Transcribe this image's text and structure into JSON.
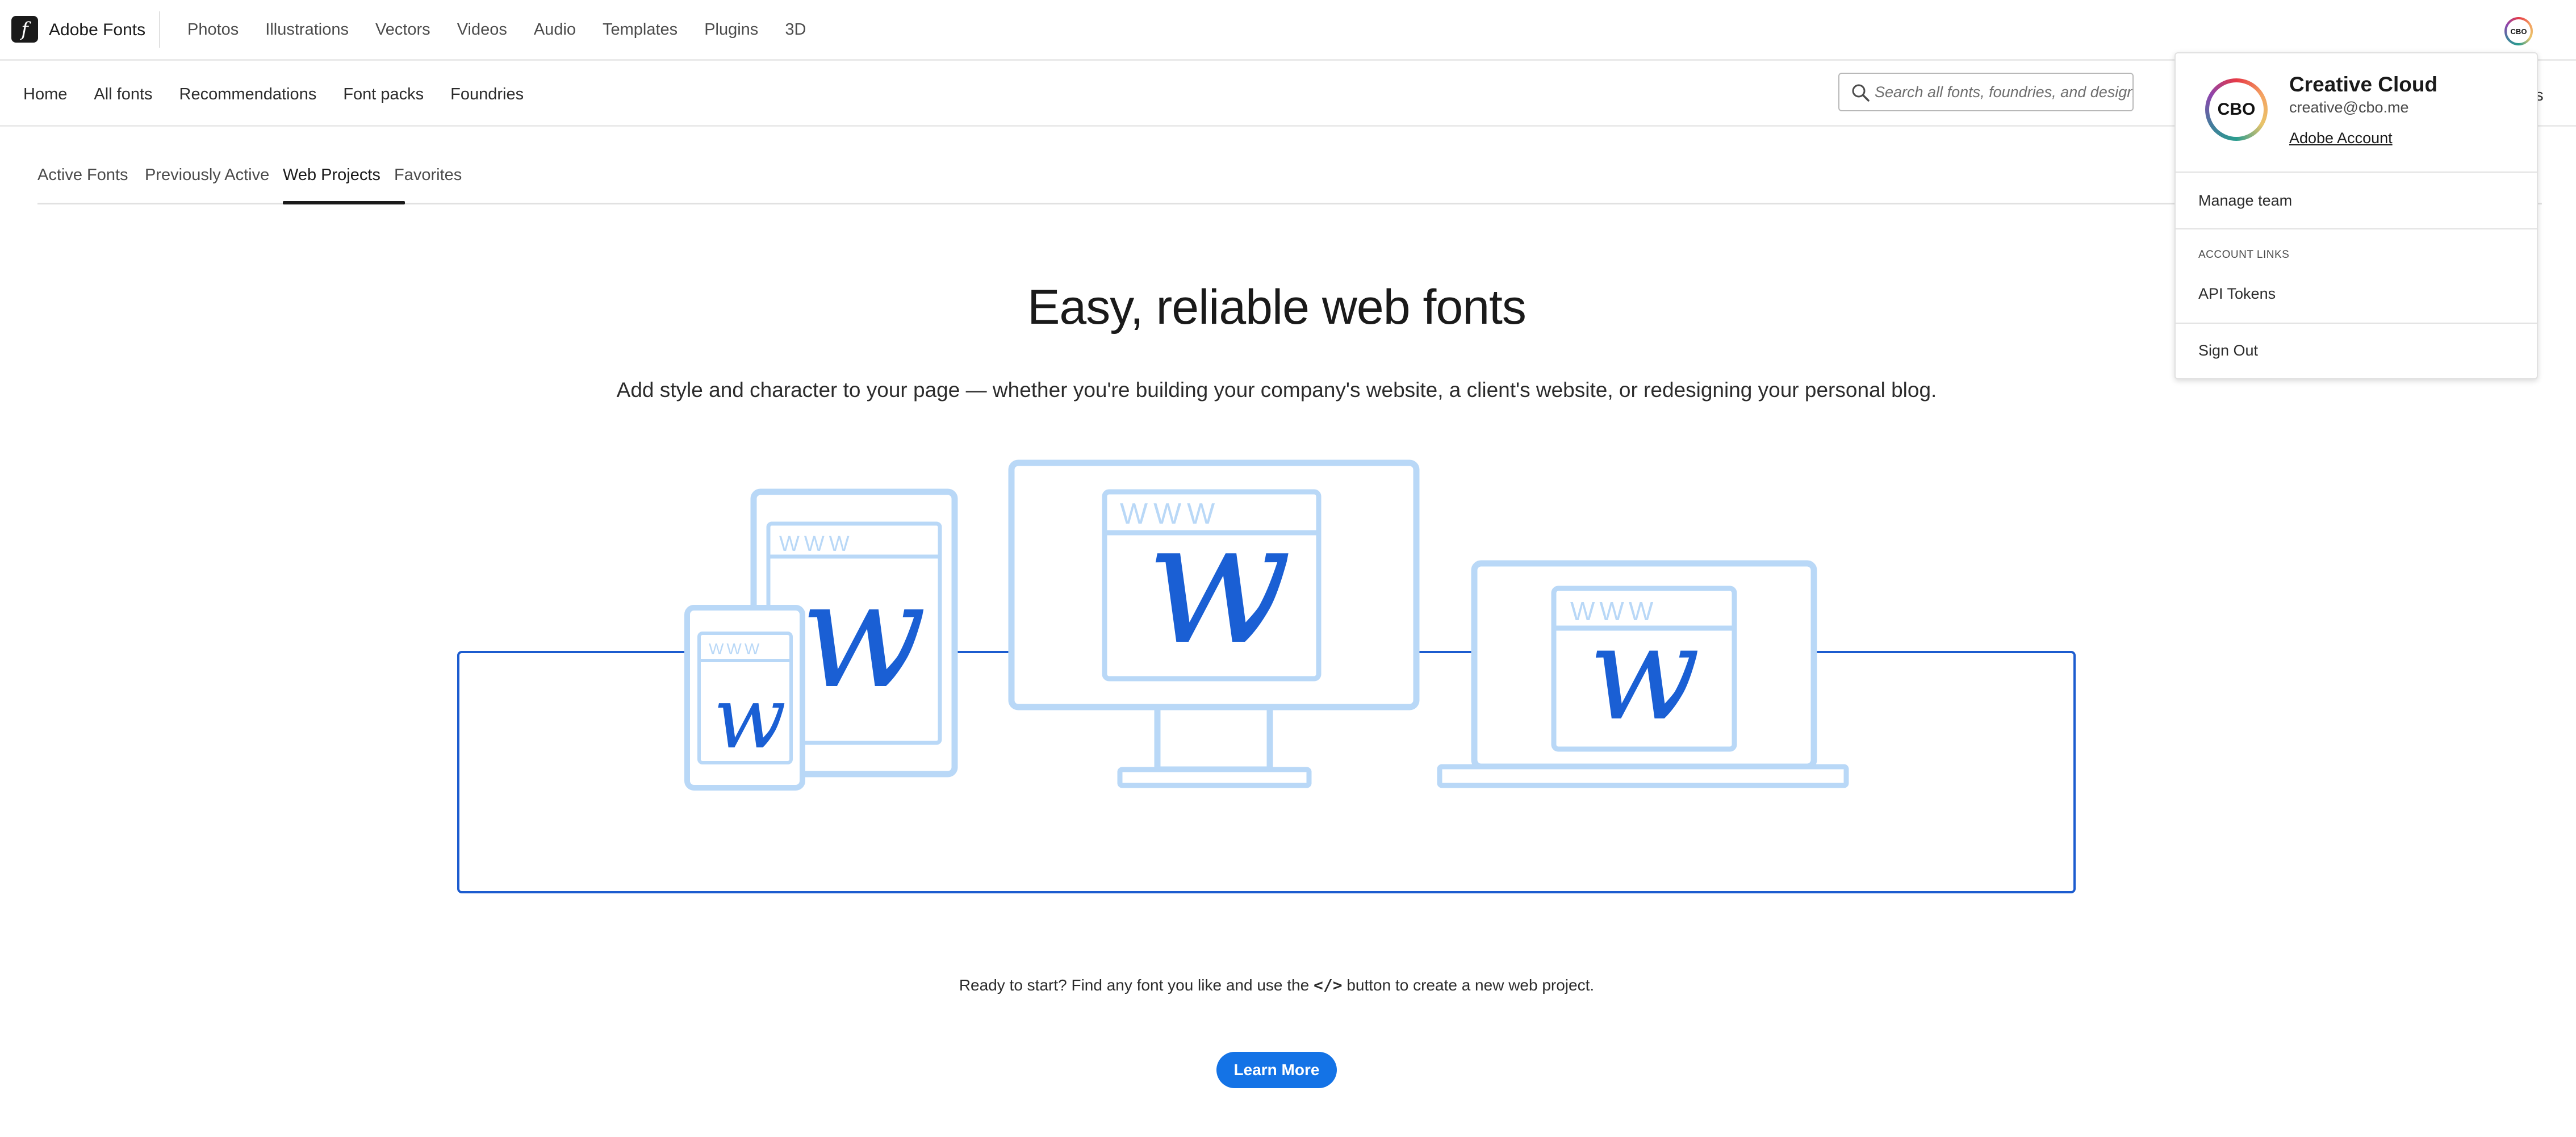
{
  "app": {
    "logo_glyph": "f",
    "brand": "Adobe Fonts",
    "avatar_initials": "CBO"
  },
  "topnav": {
    "links": [
      "Photos",
      "Illustrations",
      "Vectors",
      "Videos",
      "Audio",
      "Templates",
      "Plugins",
      "3D"
    ]
  },
  "subnav": {
    "links": [
      "Home",
      "All fonts",
      "Recommendations",
      "Font packs",
      "Foundries"
    ],
    "search_placeholder": "Search all fonts, foundries, and designers",
    "clipped_label": "nts"
  },
  "tabs": {
    "items": [
      "Active Fonts",
      "Previously Active",
      "Web Projects",
      "Favorites"
    ],
    "active": "Web Projects"
  },
  "hero": {
    "title": "Easy, reliable web fonts",
    "subtitle": "Add style and character to your page — whether you're building your company's website, a client's website, or redesigning your personal blog."
  },
  "illustration": {
    "www_label": "WWW",
    "glyph": "w",
    "colors": {
      "light": "#b9d8f7",
      "dark": "#1a5fd4",
      "frame": "#1c5ccf"
    }
  },
  "cta": {
    "ready_before": "Ready to start? Find any font you like and use the",
    "code_glyph": "</>",
    "ready_after": "button to create a new web project.",
    "learn_more": "Learn More",
    "button_color": "#1473e6"
  },
  "account_menu": {
    "avatar_initials": "CBO",
    "name": "Creative Cloud",
    "email": "creative@cbo.me",
    "account_link": "Adobe Account",
    "manage_team": "Manage team",
    "links_heading": "ACCOUNT LINKS",
    "api_tokens": "API Tokens",
    "sign_out": "Sign Out"
  }
}
